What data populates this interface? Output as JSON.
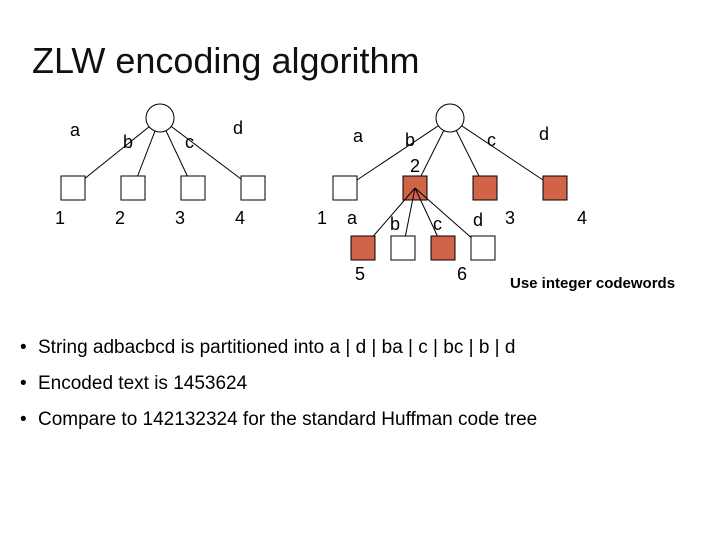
{
  "title": "ZLW encoding algorithm",
  "tree1": {
    "edge_labels": {
      "a": "a",
      "b": "b",
      "c": "c",
      "d": "d"
    },
    "leaf_labels": {
      "n1": "1",
      "n2": "2",
      "n3": "3",
      "n4": "4"
    }
  },
  "tree2": {
    "edge_labels_top": {
      "a": "a",
      "b": "b",
      "c": "c",
      "d": "d"
    },
    "mid_label": "2",
    "leaf_labels_top": {
      "n1": "1",
      "n3": "3",
      "n4": "4"
    },
    "edge_labels_bot": {
      "a": "a",
      "b": "b",
      "c": "c",
      "d": "d"
    },
    "leaf_labels_bot": {
      "n5": "5",
      "n6": "6"
    }
  },
  "annotation": "Use integer codewords",
  "bullets": [
    "String adbacbcd is partitioned into a | d | ba | c | bc | b | d",
    "Encoded text is 1453624",
    "Compare to 142132324 for the standard Huffman code tree"
  ],
  "colors": {
    "accent": "#d16349",
    "edge": "#000000",
    "node_stroke": "#000000"
  }
}
